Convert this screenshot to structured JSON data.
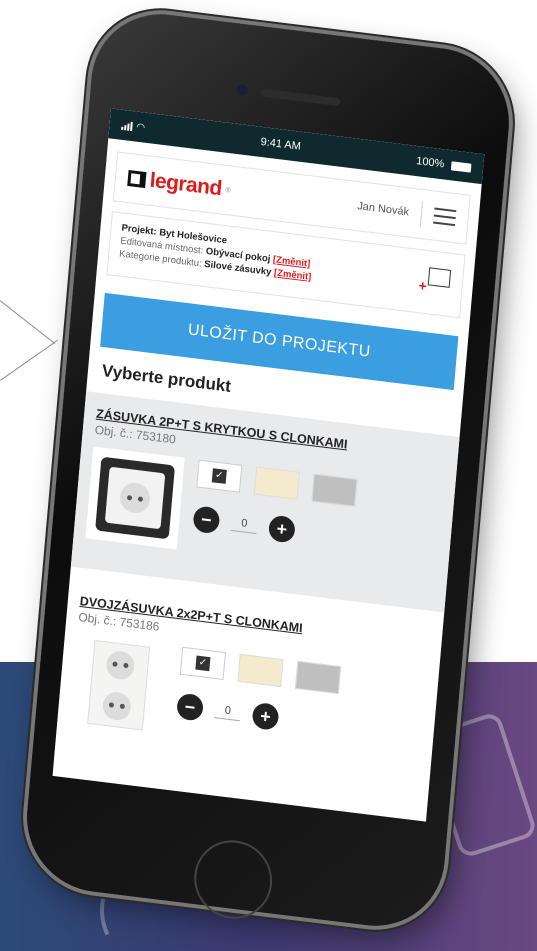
{
  "status": {
    "time": "9:41 AM",
    "battery": "100%"
  },
  "header": {
    "logo_text": "legrand",
    "logo_mark": "®",
    "user_name": "Jan Novák"
  },
  "project": {
    "title": "Projekt: Byt Holešovice",
    "room_label": "Editovaná místnost:",
    "room_value": "Obývací pokoj",
    "category_label": "Kategorie produktu:",
    "category_value": "Silové zásuvky",
    "change_link": "[Změnit]"
  },
  "actions": {
    "save_label": "ULOŽIT DO PROJEKTU"
  },
  "section": {
    "title": "Vyberte produkt"
  },
  "products": [
    {
      "name": "ZÁSUVKA 2P+T S KRYTKOU S CLONKAMI",
      "code": "Obj. č.: 753180",
      "quantity": "0",
      "minus": "−",
      "plus": "+",
      "selected_color": "white",
      "check": "✓"
    },
    {
      "name": "DVOJZÁSUVKA 2x2P+T S CLONKAMI",
      "code": "Obj. č.: 753186",
      "quantity": "0",
      "minus": "−",
      "plus": "+",
      "selected_color": "white",
      "check": "✓"
    }
  ],
  "colors": {
    "brand_red": "#e01a1a",
    "button_blue": "#3a9ee0",
    "swatch_ivory": "#f4ebcf",
    "swatch_grey": "#bfbfbf"
  }
}
